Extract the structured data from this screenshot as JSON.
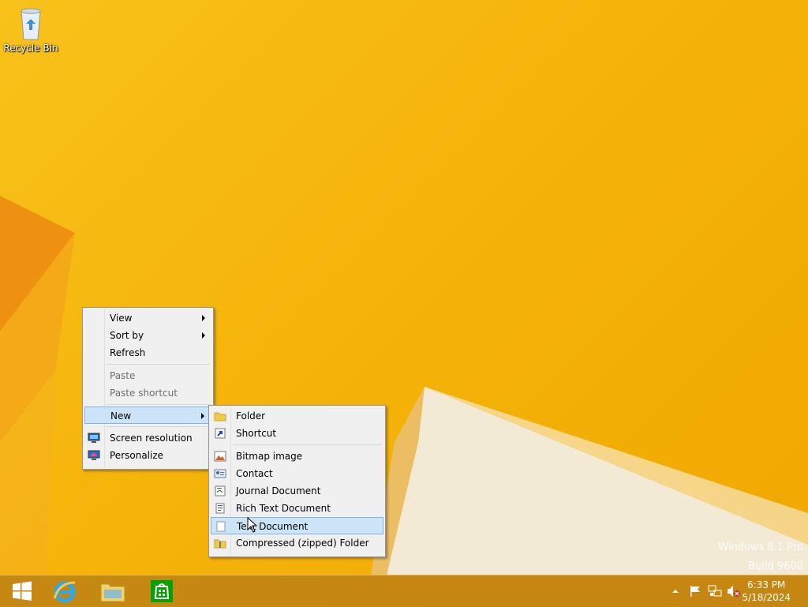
{
  "desktop": {
    "icons": [
      {
        "label": "Recycle Bin",
        "icon": "recycle-bin-icon"
      }
    ],
    "watermark": {
      "line1": "Windows 8.1 Pro",
      "line2": "Build 9600"
    }
  },
  "context_menu": {
    "items": [
      {
        "label": "View",
        "has_submenu": true,
        "enabled": true
      },
      {
        "label": "Sort by",
        "has_submenu": true,
        "enabled": true
      },
      {
        "label": "Refresh",
        "has_submenu": false,
        "enabled": true
      },
      {
        "label": "Paste",
        "has_submenu": false,
        "enabled": false
      },
      {
        "label": "Paste shortcut",
        "has_submenu": false,
        "enabled": false
      },
      {
        "label": "New",
        "has_submenu": true,
        "enabled": true,
        "highlighted": true
      },
      {
        "label": "Screen resolution",
        "icon": "screen-resolution-icon",
        "enabled": true
      },
      {
        "label": "Personalize",
        "icon": "personalize-icon",
        "enabled": true
      }
    ]
  },
  "new_submenu": {
    "items": [
      {
        "label": "Folder",
        "icon": "folder-icon"
      },
      {
        "label": "Shortcut",
        "icon": "shortcut-icon"
      },
      {
        "label": "Bitmap image",
        "icon": "bitmap-icon"
      },
      {
        "label": "Contact",
        "icon": "contact-icon"
      },
      {
        "label": "Journal Document",
        "icon": "journal-icon"
      },
      {
        "label": "Rich Text Document",
        "icon": "rich-text-icon"
      },
      {
        "label": "Text Document",
        "icon": "text-document-icon",
        "highlighted": true
      },
      {
        "label": "Compressed (zipped) Folder",
        "icon": "zip-folder-icon"
      }
    ]
  },
  "taskbar": {
    "pinned": [
      "start-button",
      "internet-explorer-icon",
      "file-explorer-icon",
      "store-icon"
    ],
    "tray_icons": [
      "show-hidden-icons",
      "action-center-flag-icon",
      "network-icon",
      "volume-muted-icon"
    ],
    "clock": {
      "time": "6:33 PM",
      "date": "5/18/2024"
    }
  },
  "colors": {
    "wallpaper": "#f5b40a",
    "menu_bg": "#f0f0f0",
    "menu_highlight": "#cce4f7",
    "menu_highlight_border": "#7eb4ea",
    "taskbar": "#be8214"
  }
}
